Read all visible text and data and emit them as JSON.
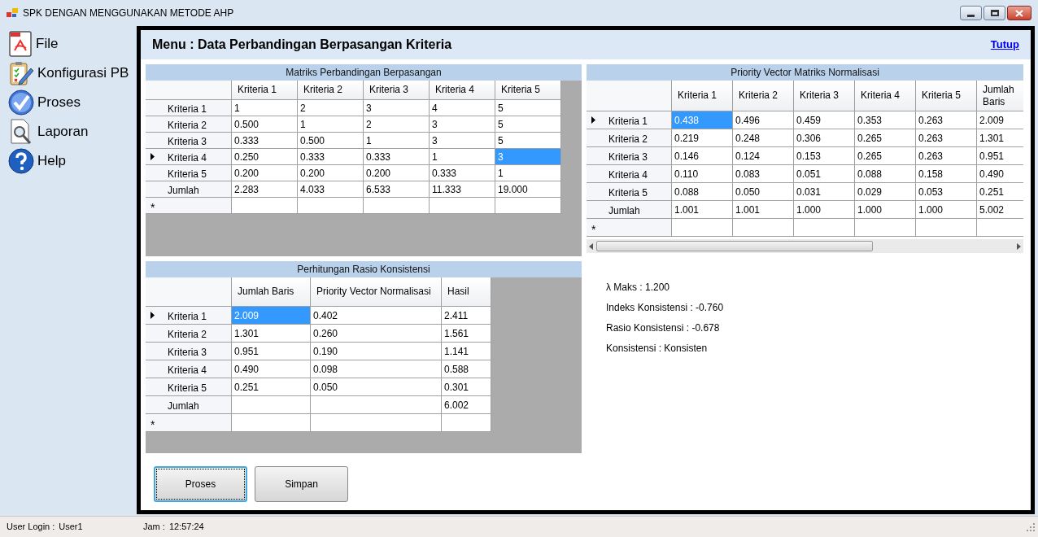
{
  "window": {
    "title": "SPK DENGAN MENGGUNAKAN METODE AHP"
  },
  "sidebar": {
    "items": [
      {
        "kind": "file",
        "label": "File"
      },
      {
        "kind": "config",
        "label": "Konfigurasi PB"
      },
      {
        "kind": "process",
        "label": "Proses"
      },
      {
        "kind": "report",
        "label": "Laporan"
      },
      {
        "kind": "help",
        "label": "Help"
      }
    ]
  },
  "header": {
    "title": "Menu : Data Perbandingan Berpasangan Kriteria",
    "close_link": "Tutup"
  },
  "matrix": {
    "title": "Matriks Perbandingan Berpasangan",
    "new_row_marker": "*",
    "columns": [
      "Kriteria 1",
      "Kriteria 2",
      "Kriteria 3",
      "Kriteria 4",
      "Kriteria 5"
    ],
    "rows": [
      {
        "header": "Kriteria 1",
        "current": false,
        "cells": [
          {
            "text": "1",
            "selected": false
          },
          {
            "text": "2",
            "selected": false
          },
          {
            "text": "3",
            "selected": false
          },
          {
            "text": "4",
            "selected": false
          },
          {
            "text": "5",
            "selected": false
          }
        ]
      },
      {
        "header": "Kriteria 2",
        "current": false,
        "cells": [
          {
            "text": "0.500",
            "selected": false
          },
          {
            "text": "1",
            "selected": false
          },
          {
            "text": "2",
            "selected": false
          },
          {
            "text": "3",
            "selected": false
          },
          {
            "text": "5",
            "selected": false
          }
        ]
      },
      {
        "header": "Kriteria 3",
        "current": false,
        "cells": [
          {
            "text": "0.333",
            "selected": false
          },
          {
            "text": "0.500",
            "selected": false
          },
          {
            "text": "1",
            "selected": false
          },
          {
            "text": "3",
            "selected": false
          },
          {
            "text": "5",
            "selected": false
          }
        ]
      },
      {
        "header": "Kriteria 4",
        "current": true,
        "cells": [
          {
            "text": "0.250",
            "selected": false
          },
          {
            "text": "0.333",
            "selected": false
          },
          {
            "text": "0.333",
            "selected": false
          },
          {
            "text": "1",
            "selected": false
          },
          {
            "text": "3",
            "selected": true
          }
        ]
      },
      {
        "header": "Kriteria 5",
        "current": false,
        "cells": [
          {
            "text": "0.200",
            "selected": false
          },
          {
            "text": "0.200",
            "selected": false
          },
          {
            "text": "0.200",
            "selected": false
          },
          {
            "text": "0.333",
            "selected": false
          },
          {
            "text": "1",
            "selected": false
          }
        ]
      },
      {
        "header": "Jumlah",
        "current": false,
        "cells": [
          {
            "text": "2.283",
            "selected": false
          },
          {
            "text": "4.033",
            "selected": false
          },
          {
            "text": "6.533",
            "selected": false
          },
          {
            "text": "11.333",
            "selected": false
          },
          {
            "text": "19.000",
            "selected": false
          }
        ]
      }
    ]
  },
  "normalized": {
    "title": "Priority Vector Matriks Normalisasi",
    "new_row_marker": "*",
    "columns": [
      "Kriteria 1",
      "Kriteria 2",
      "Kriteria 3",
      "Kriteria 4",
      "Kriteria 5",
      "Jumlah Baris"
    ],
    "rows": [
      {
        "header": "Kriteria 1",
        "current": true,
        "cells": [
          {
            "text": "0.438",
            "selected": true
          },
          {
            "text": "0.496",
            "selected": false
          },
          {
            "text": "0.459",
            "selected": false
          },
          {
            "text": "0.353",
            "selected": false
          },
          {
            "text": "0.263",
            "selected": false
          },
          {
            "text": "2.009",
            "selected": false
          }
        ]
      },
      {
        "header": "Kriteria 2",
        "current": false,
        "cells": [
          {
            "text": "0.219",
            "selected": false
          },
          {
            "text": "0.248",
            "selected": false
          },
          {
            "text": "0.306",
            "selected": false
          },
          {
            "text": "0.265",
            "selected": false
          },
          {
            "text": "0.263",
            "selected": false
          },
          {
            "text": "1.301",
            "selected": false
          }
        ]
      },
      {
        "header": "Kriteria 3",
        "current": false,
        "cells": [
          {
            "text": "0.146",
            "selected": false
          },
          {
            "text": "0.124",
            "selected": false
          },
          {
            "text": "0.153",
            "selected": false
          },
          {
            "text": "0.265",
            "selected": false
          },
          {
            "text": "0.263",
            "selected": false
          },
          {
            "text": "0.951",
            "selected": false
          }
        ]
      },
      {
        "header": "Kriteria 4",
        "current": false,
        "cells": [
          {
            "text": "0.110",
            "selected": false
          },
          {
            "text": "0.083",
            "selected": false
          },
          {
            "text": "0.051",
            "selected": false
          },
          {
            "text": "0.088",
            "selected": false
          },
          {
            "text": "0.158",
            "selected": false
          },
          {
            "text": "0.490",
            "selected": false
          }
        ]
      },
      {
        "header": "Kriteria 5",
        "current": false,
        "cells": [
          {
            "text": "0.088",
            "selected": false
          },
          {
            "text": "0.050",
            "selected": false
          },
          {
            "text": "0.031",
            "selected": false
          },
          {
            "text": "0.029",
            "selected": false
          },
          {
            "text": "0.053",
            "selected": false
          },
          {
            "text": "0.251",
            "selected": false
          }
        ]
      },
      {
        "header": "Jumlah",
        "current": false,
        "cells": [
          {
            "text": "1.001",
            "selected": false
          },
          {
            "text": "1.001",
            "selected": false
          },
          {
            "text": "1.000",
            "selected": false
          },
          {
            "text": "1.000",
            "selected": false
          },
          {
            "text": "1.000",
            "selected": false
          },
          {
            "text": "5.002",
            "selected": false
          }
        ]
      }
    ]
  },
  "consistency": {
    "title": "Perhitungan Rasio Konsistensi",
    "new_row_marker": "*",
    "columns": [
      "Jumlah Baris",
      "Priority Vector Normalisasi",
      "Hasil"
    ],
    "rows": [
      {
        "header": "Kriteria 1",
        "current": true,
        "cells": [
          {
            "text": "2.009",
            "selected": true
          },
          {
            "text": "0.402",
            "selected": false
          },
          {
            "text": "2.411",
            "selected": false
          }
        ]
      },
      {
        "header": "Kriteria 2",
        "current": false,
        "cells": [
          {
            "text": "1.301",
            "selected": false
          },
          {
            "text": "0.260",
            "selected": false
          },
          {
            "text": "1.561",
            "selected": false
          }
        ]
      },
      {
        "header": "Kriteria 3",
        "current": false,
        "cells": [
          {
            "text": "0.951",
            "selected": false
          },
          {
            "text": "0.190",
            "selected": false
          },
          {
            "text": "1.141",
            "selected": false
          }
        ]
      },
      {
        "header": "Kriteria 4",
        "current": false,
        "cells": [
          {
            "text": "0.490",
            "selected": false
          },
          {
            "text": "0.098",
            "selected": false
          },
          {
            "text": "0.588",
            "selected": false
          }
        ]
      },
      {
        "header": "Kriteria 5",
        "current": false,
        "cells": [
          {
            "text": "0.251",
            "selected": false
          },
          {
            "text": "0.050",
            "selected": false
          },
          {
            "text": "0.301",
            "selected": false
          }
        ]
      },
      {
        "header": "Jumlah",
        "current": false,
        "cells": [
          {
            "selected": false
          },
          {
            "selected": false
          },
          {
            "text": "6.002",
            "selected": false
          }
        ]
      }
    ]
  },
  "buttons": [
    {
      "label": "Proses",
      "focused": true
    },
    {
      "label": "Simpan",
      "focused": false
    }
  ],
  "results": [
    "λ Maks : 1.200",
    "Indeks Konsistensi : -0.760",
    "Rasio Konsistensi : -0.678",
    "Konsistensi : Konsisten"
  ],
  "status_bar": [
    {
      "label": "User Login :",
      "value": "User1"
    },
    {
      "label": "Jam :",
      "value": "12:57:24"
    }
  ]
}
